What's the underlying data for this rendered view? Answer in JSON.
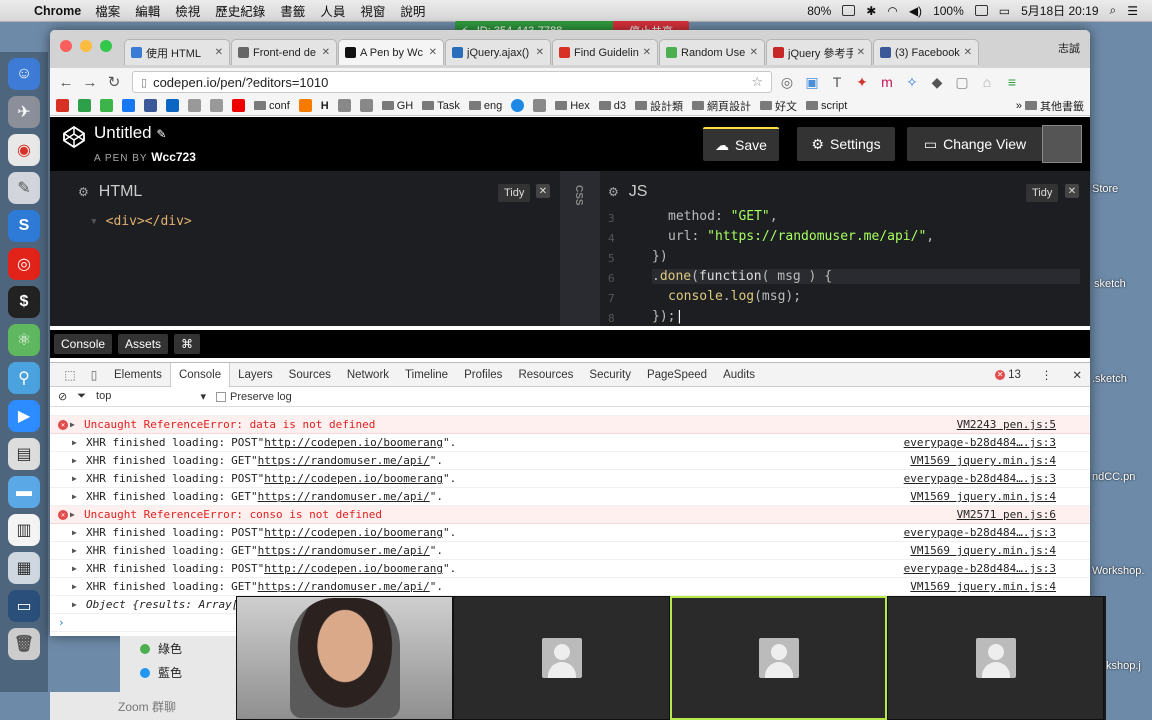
{
  "menubar": {
    "app": "Chrome",
    "items": [
      "檔案",
      "編輯",
      "檢視",
      "歷史紀錄",
      "書籤",
      "人員",
      "視窗",
      "說明"
    ],
    "cpu": "80%",
    "battery": "100%",
    "date_time": "5月18日 20:19"
  },
  "zoom_share": {
    "id_label": "ID: 354-443-7788",
    "stop_label": "停止共享"
  },
  "browser": {
    "profile": "志誠",
    "tabs": [
      {
        "label": "使用 HTML",
        "color": "#3a7bd5",
        "active": false
      },
      {
        "label": "Front-end de",
        "color": "#666666",
        "active": false
      },
      {
        "label": "A Pen by Wc",
        "color": "#111111",
        "active": true
      },
      {
        "label": "jQuery.ajax()",
        "color": "#2a6ebb",
        "active": false
      },
      {
        "label": "Find Guideline",
        "color": "#d93025",
        "active": false
      },
      {
        "label": "Random User",
        "color": "#4caf50",
        "active": false
      },
      {
        "label": "jQuery 參考手",
        "color": "#c62828",
        "active": false
      },
      {
        "label": "(3) Facebook",
        "color": "#3b5998",
        "active": false
      }
    ],
    "url": "codepen.io/pen/?editors=1010",
    "bookmarks": [
      "conf",
      "H",
      "GH",
      "Task",
      "eng",
      "Hex",
      "d3",
      "設計類",
      "網頁設計",
      "好文",
      "script",
      "其他書籤"
    ]
  },
  "codepen": {
    "title": "Untitled",
    "by_label": "A PEN BY",
    "author": "Wcc723",
    "save_label": "Save",
    "settings_label": "Settings",
    "change_view_label": "Change View",
    "html_label": "HTML",
    "css_label": "CSS",
    "js_label": "JS",
    "tidy_label": "Tidy",
    "html_code": "<div></div>",
    "js_lines": [
      "3",
      "4",
      "5",
      "6",
      "7",
      "8"
    ],
    "console_label": "Console",
    "assets_label": "Assets",
    "cmd_label": "⌘"
  },
  "devtools": {
    "tabs": [
      "Elements",
      "Console",
      "Layers",
      "Sources",
      "Network",
      "Timeline",
      "Profiles",
      "Resources",
      "Security",
      "PageSpeed",
      "Audits"
    ],
    "active_tab": "Console",
    "error_count": "13",
    "context": "top",
    "preserve_log": "Preserve log",
    "rows": [
      {
        "type": "err",
        "text": "Uncaught ReferenceError: data is not defined",
        "src": "VM2243 pen.js:5"
      },
      {
        "type": "xhr",
        "method": "POST",
        "url": "http://codepen.io/boomerang",
        "src": "everypage-b28d484….js:3"
      },
      {
        "type": "xhr",
        "method": "GET",
        "url": "https://randomuser.me/api/",
        "src": "VM1569 jquery.min.js:4"
      },
      {
        "type": "xhr",
        "method": "POST",
        "url": "http://codepen.io/boomerang",
        "src": "everypage-b28d484….js:3"
      },
      {
        "type": "xhr",
        "method": "GET",
        "url": "https://randomuser.me/api/",
        "src": "VM1569 jquery.min.js:4"
      },
      {
        "type": "err",
        "text": "Uncaught ReferenceError: conso is not defined",
        "src": "VM2571 pen.js:6"
      },
      {
        "type": "xhr",
        "method": "POST",
        "url": "http://codepen.io/boomerang",
        "src": "everypage-b28d484….js:3"
      },
      {
        "type": "xhr",
        "method": "GET",
        "url": "https://randomuser.me/api/",
        "src": "VM1569 jquery.min.js:4"
      },
      {
        "type": "xhr",
        "method": "POST",
        "url": "http://codepen.io/boomerang",
        "src": "everypage-b28d484….js:3"
      },
      {
        "type": "xhr",
        "method": "GET",
        "url": "https://randomuser.me/api/",
        "src": "VM1569 jquery.min.js:4"
      },
      {
        "type": "obj",
        "text": "Object {results: Array[",
        "src": ""
      }
    ],
    "xhr_prefix": "XHR finished loading:"
  },
  "zoom_side": {
    "items": [
      {
        "label": "綠色",
        "color": "#4caf50"
      },
      {
        "label": "藍色",
        "color": "#2196f3"
      }
    ],
    "group_label": "Zoom 群聊"
  },
  "desktop_labels": [
    "Store",
    "sketch",
    ".sketch",
    "ndCC.pn",
    "Workshop.",
    "kshop.j"
  ]
}
